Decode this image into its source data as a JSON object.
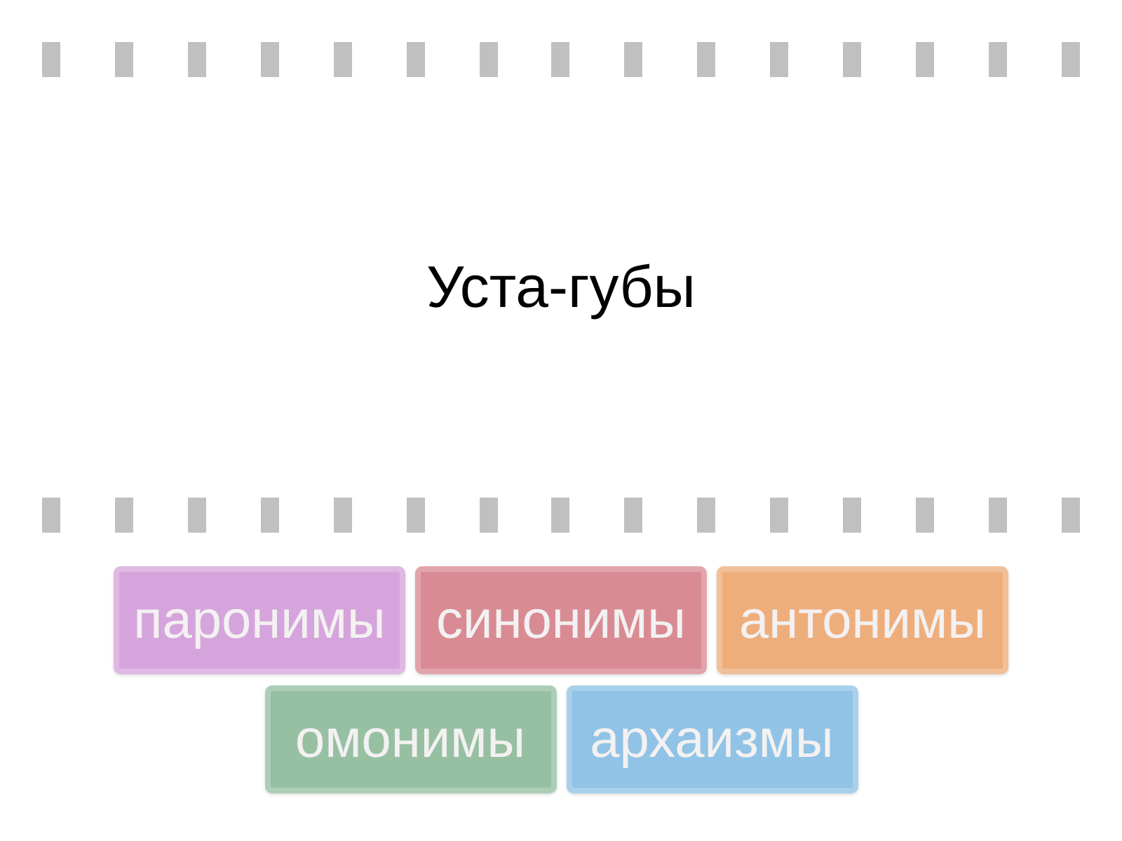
{
  "card": {
    "prompt": "Уста-губы"
  },
  "tiles": [
    {
      "label": "паронимы",
      "color": "#d6a4dc"
    },
    {
      "label": "синонимы",
      "color": "#d98b93"
    },
    {
      "label": "антонимы",
      "color": "#eeae7c"
    },
    {
      "label": "омонимы",
      "color": "#97c0a2"
    },
    {
      "label": "архаизмы",
      "color": "#90c3e6"
    }
  ]
}
